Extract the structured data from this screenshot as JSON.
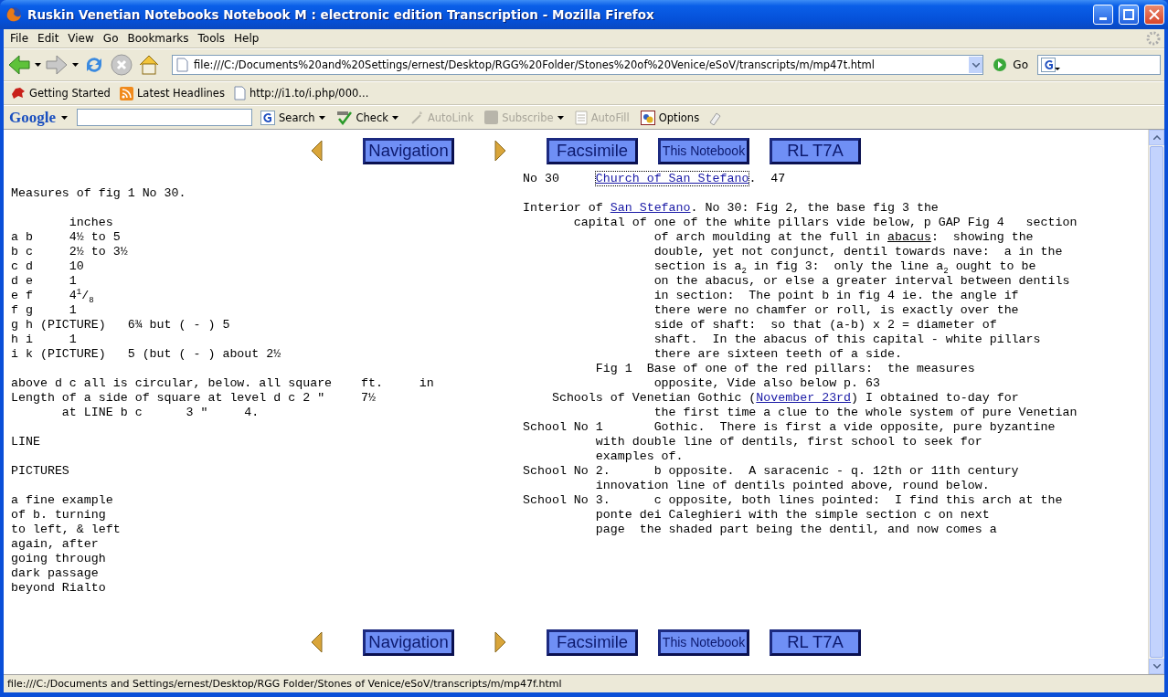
{
  "window": {
    "title": "Ruskin Venetian Notebooks Notebook M : electronic edition Transcription - Mozilla Firefox"
  },
  "menu": [
    "File",
    "Edit",
    "View",
    "Go",
    "Bookmarks",
    "Tools",
    "Help"
  ],
  "address": {
    "value": "file:///C:/Documents%20and%20Settings/ernest/Desktop/RGG%20Folder/Stones%20of%20Venice/eSoV/transcripts/m/mp47t.html",
    "go": "Go"
  },
  "bookmarks": [
    {
      "label": "Getting Started",
      "kind": "site"
    },
    {
      "label": "Latest Headlines",
      "kind": "feed"
    },
    {
      "label": "http://i1.to/i.php/000...",
      "kind": "page"
    }
  ],
  "google_toolbar": {
    "logo": "Google",
    "items": [
      {
        "label": "Search",
        "kind": "search",
        "disabled": false,
        "menu": true
      },
      {
        "label": "Check",
        "kind": "check",
        "disabled": false,
        "menu": true
      },
      {
        "label": "AutoLink",
        "kind": "autolink",
        "disabled": true,
        "menu": false
      },
      {
        "label": "Subscribe",
        "kind": "feed",
        "disabled": true,
        "menu": true
      },
      {
        "label": "AutoFill",
        "kind": "autofill",
        "disabled": true,
        "menu": false
      },
      {
        "label": "Options",
        "kind": "options",
        "disabled": false,
        "menu": false
      }
    ]
  },
  "top_nav": [
    {
      "kind": "prev"
    },
    {
      "kind": "button",
      "label": "Navigation"
    },
    {
      "kind": "next"
    },
    {
      "kind": "button",
      "label": "Facsimile"
    },
    {
      "kind": "small-button",
      "label": "This Notebook"
    },
    {
      "kind": "button",
      "label": "RL T7A"
    }
  ],
  "left_column": [
    [
      "Measures of fig 1 No 30."
    ],
    [
      "        inches",
      "a b     4½ to 5",
      "b c     2½ to 3½",
      "c d     10",
      "d e     1",
      "e f     4$^{1}$/$_{8}$",
      "f g     1",
      "g h (PICTURE)   6¾ but ( - ) 5",
      "h i     1",
      "i k (PICTURE)   5 (but ( - ) about 2½"
    ],
    [
      "above d c all is circular, below. all square    ft.     in",
      "Length of a side of square at level d c 2 ″     7½",
      "       at LINE b c      3 ″     4."
    ],
    [
      "LINE"
    ],
    [
      "PICTURES"
    ],
    [
      "a fine example",
      "of b. turning",
      "to left, & left",
      "again, after",
      "going through",
      "dark passage",
      "beyond Rialto"
    ]
  ],
  "right_column": [
    [
      [
        {
          "text": "No 30     ",
          "kind": "plain"
        },
        {
          "text": "Church of San Stefano",
          "kind": "link",
          "focused": true
        },
        {
          "text": ".  47",
          "kind": "plain"
        }
      ]
    ],
    [
      [
        {
          "text": "Interior of ",
          "kind": "plain"
        },
        {
          "text": "San Stefano",
          "kind": "link",
          "focused": false
        },
        {
          "text": ". No 30: Fig 2, the base fig 3 the",
          "kind": "plain"
        }
      ],
      [
        {
          "text": "       capital of one of the white pillars vide below, p GAP Fig 4   section",
          "kind": "plain"
        }
      ],
      [
        {
          "text": "                  of arch moulding at the full in ",
          "kind": "plain"
        },
        {
          "text": "abacus",
          "kind": "underlined"
        },
        {
          "text": ":  showing the",
          "kind": "plain"
        }
      ],
      [
        {
          "text": "                  double, yet not conjunct, dentil towards nave:  a in the",
          "kind": "plain"
        }
      ],
      [
        {
          "text": "                  section is a$_{2}$ in fig 3:  only the line a$_{2}$ ought to be",
          "kind": "plain"
        }
      ],
      [
        {
          "text": "                  on the abacus, or else a greater interval between dentils",
          "kind": "plain"
        }
      ],
      [
        {
          "text": "                  in section:  The point b in fig 4 ie. the angle if",
          "kind": "plain"
        }
      ],
      [
        {
          "text": "                  there were no chamfer or roll, is exactly over the",
          "kind": "plain"
        }
      ],
      [
        {
          "text": "                  side of shaft:  so that (a-b) x 2 = diameter of",
          "kind": "plain"
        }
      ],
      [
        {
          "text": "                  shaft.  In the abacus of this capital - white pillars",
          "kind": "plain"
        }
      ],
      [
        {
          "text": "                  there are sixteen teeth of a side.",
          "kind": "plain"
        }
      ],
      [
        {
          "text": "          Fig 1  Base of one of the red pillars:  the measures",
          "kind": "plain"
        }
      ],
      [
        {
          "text": "                  opposite, Vide also below p. 63",
          "kind": "plain"
        }
      ],
      [
        {
          "text": "    Schools of Venetian Gothic (",
          "kind": "plain"
        },
        {
          "text": "November 23rd",
          "kind": "link",
          "focused": false
        },
        {
          "text": ") I obtained to-day for",
          "kind": "plain"
        }
      ],
      [
        {
          "text": "                  the first time a clue to the whole system of pure Venetian",
          "kind": "plain"
        }
      ],
      [
        {
          "text": "School No 1       Gothic.  There is first a vide opposite, pure byzantine",
          "kind": "plain"
        }
      ],
      [
        {
          "text": "          with double line of dentils, first school to seek for",
          "kind": "plain"
        }
      ],
      [
        {
          "text": "          examples of.",
          "kind": "plain"
        }
      ],
      [
        {
          "text": "School No 2.      b opposite.  A saracenic - q. 12th or 11th century",
          "kind": "plain"
        }
      ],
      [
        {
          "text": "          innovation line of dentils pointed above, round below.",
          "kind": "plain"
        }
      ],
      [
        {
          "text": "School No 3.      c opposite, both lines pointed:  I find this arch at the",
          "kind": "plain"
        }
      ],
      [
        {
          "text": "          ponte dei Caleghieri with the simple section c on next",
          "kind": "plain"
        }
      ],
      [
        {
          "text": "          page  the shaded part being the dentil, and now comes a",
          "kind": "plain"
        }
      ]
    ]
  ],
  "bottom_nav": [
    {
      "kind": "prev"
    },
    {
      "kind": "button",
      "label": "Navigation"
    },
    {
      "kind": "next"
    },
    {
      "kind": "button",
      "label": "Facsimile"
    },
    {
      "kind": "small-button",
      "label": "This Notebook"
    },
    {
      "kind": "button",
      "label": "RL T7A"
    }
  ],
  "status_bar": "file:///C:/Documents and Settings/ernest/Desktop/RGG Folder/Stones of Venice/eSoV/transcripts/m/mp47f.html"
}
